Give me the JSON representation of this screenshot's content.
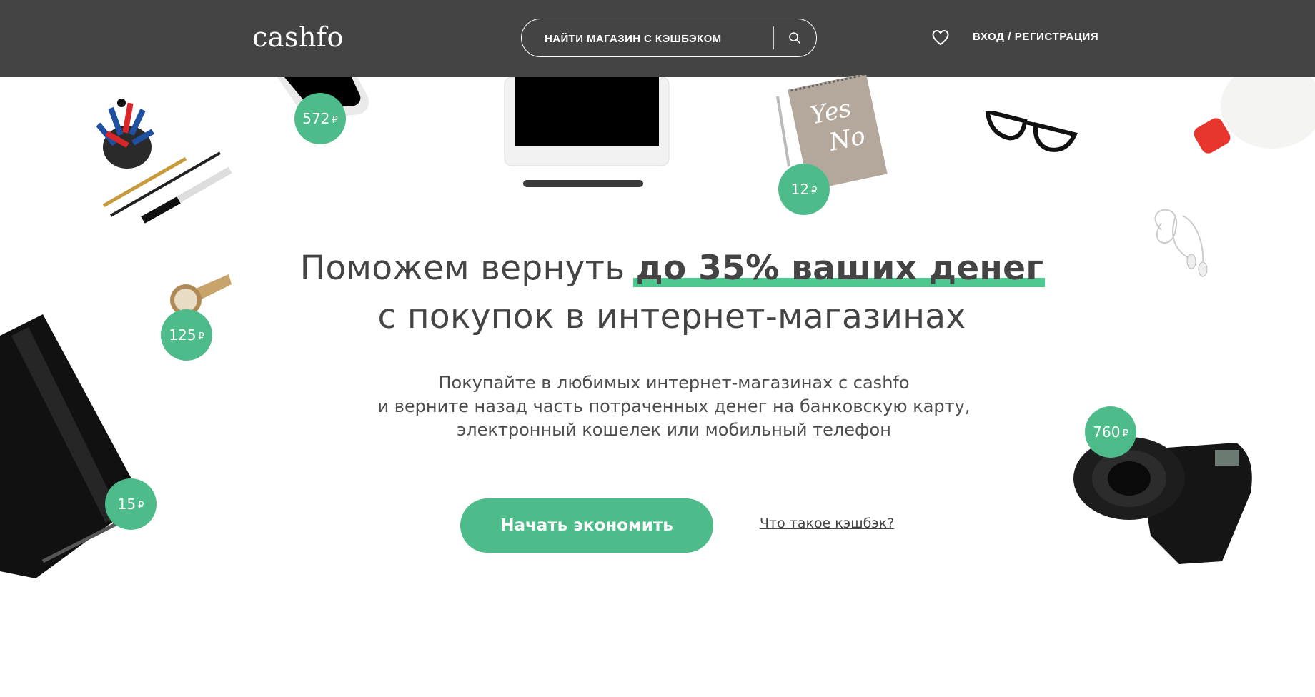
{
  "header": {
    "logo": "cashfo",
    "search_placeholder": "НАЙТИ МАГАЗИН С КЭШБЭКОМ",
    "login_label": "ВХОД / РЕГИСТРАЦИЯ"
  },
  "hero": {
    "headline_pre": "Поможем вернуть",
    "headline_highlight": "до 35% ваших денег",
    "headline_line2": "с покупок в интернет-магазинах",
    "sub_line1": "Покупайте в любимых интернет-магазинах с cashfo",
    "sub_line2": "и верните назад часть потраченных денег на банковскую карту,",
    "sub_line3": "электронный кошелек или мобильный телефон",
    "cta_label": "Начать экономить",
    "link_label": "Что такое кэшбэк?"
  },
  "badges": {
    "phone": "572",
    "notebook_yesno": "12",
    "watch": "125",
    "notepad": "15",
    "camera": "760",
    "currency": "₽"
  },
  "colors": {
    "header_bg": "#444444",
    "accent": "#4dbb8a"
  }
}
